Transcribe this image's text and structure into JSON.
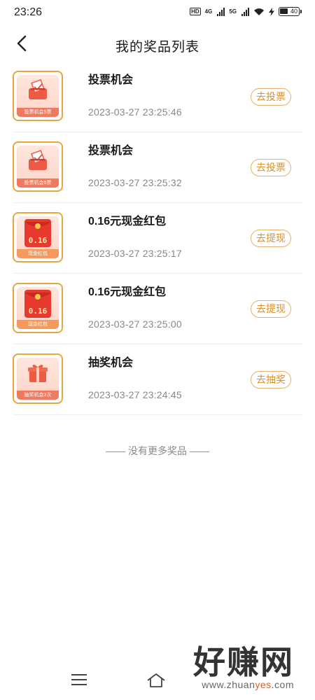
{
  "status": {
    "time": "23:26",
    "hd": "HD",
    "net1": "4G",
    "net2": "5G",
    "battery": "40"
  },
  "header": {
    "title": "我的奖品列表"
  },
  "prizes": [
    {
      "name": "投票机会",
      "date": "2023-03-27 23:25:46",
      "action": "去投票",
      "thumb_caption": "投票机会5票",
      "icon": "vote-box-icon"
    },
    {
      "name": "投票机会",
      "date": "2023-03-27 23:25:32",
      "action": "去投票",
      "thumb_caption": "投票机会5票",
      "icon": "vote-box-icon"
    },
    {
      "name": "0.16元现金红包",
      "date": "2023-03-27 23:25:17",
      "action": "去提现",
      "thumb_caption": "现金红包",
      "thumb_amount": "0.16",
      "icon": "red-envelope-icon"
    },
    {
      "name": "0.16元现金红包",
      "date": "2023-03-27 23:25:00",
      "action": "去提现",
      "thumb_caption": "现金红包",
      "thumb_amount": "0.16",
      "icon": "red-envelope-icon"
    },
    {
      "name": "抽奖机会",
      "date": "2023-03-27 23:24:45",
      "action": "去抽奖",
      "thumb_caption": "抽奖机会3次",
      "icon": "gift-box-icon"
    }
  ],
  "footer_note": "—— 没有更多奖品 ——",
  "watermark": {
    "logo": "好赚网",
    "url_prefix": "www.zhuan",
    "url_highlight": "yes",
    "url_suffix": ".com"
  },
  "colors": {
    "accent": "#d9902f",
    "accent_border": "#e6b06a",
    "thumb_border": "#e9a640",
    "envelope_red": "#e8392f"
  }
}
